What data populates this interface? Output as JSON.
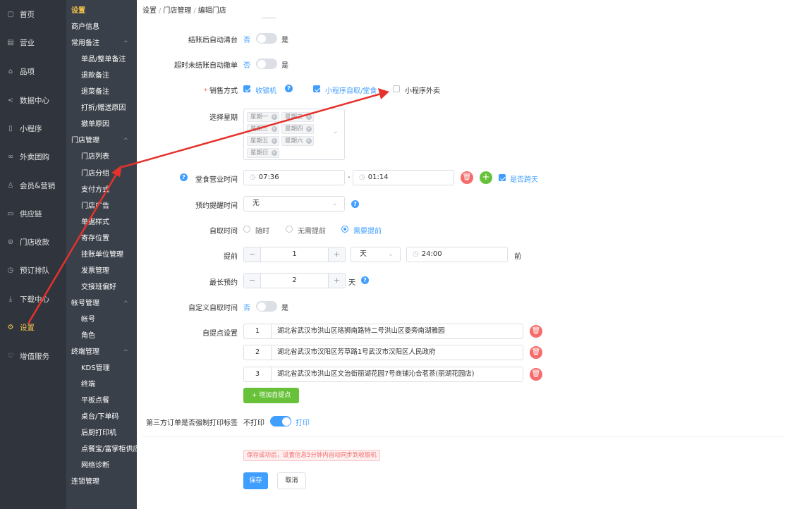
{
  "nav_main": [
    {
      "label": "首页",
      "icon": "home-icon",
      "glyph": "▢",
      "active": false
    },
    {
      "label": "营业",
      "icon": "business-icon",
      "glyph": "▤",
      "active": false
    },
    {
      "label": "品项",
      "icon": "product-icon",
      "glyph": "⌂",
      "active": false
    },
    {
      "label": "数据中心",
      "icon": "share-icon",
      "glyph": "<",
      "active": false
    },
    {
      "label": "小程序",
      "icon": "phone-icon",
      "glyph": "▯",
      "active": false
    },
    {
      "label": "外卖团购",
      "icon": "delivery-icon",
      "glyph": "∞",
      "active": false
    },
    {
      "label": "会员&营销",
      "icon": "user-icon",
      "glyph": "♙",
      "active": false
    },
    {
      "label": "供应链",
      "icon": "truck-icon",
      "glyph": "▭",
      "active": false
    },
    {
      "label": "门店收款",
      "icon": "cashier-icon",
      "glyph": "⊜",
      "active": false
    },
    {
      "label": "预订排队",
      "icon": "clock-icon",
      "glyph": "◷",
      "active": false
    },
    {
      "label": "下载中心",
      "icon": "download-icon",
      "glyph": "⤓",
      "active": false
    },
    {
      "label": "设置",
      "icon": "settings-icon",
      "glyph": "⚙",
      "active": true
    },
    {
      "label": "增值服务",
      "icon": "gift-icon",
      "glyph": "♡",
      "active": false
    }
  ],
  "nav_sub": [
    {
      "type": "title",
      "label": "设置"
    },
    {
      "type": "group",
      "label": "商户信息"
    },
    {
      "type": "group",
      "label": "常用备注",
      "caret": "^"
    },
    {
      "type": "sub",
      "label": "单品/整单备注"
    },
    {
      "type": "sub",
      "label": "退款备注"
    },
    {
      "type": "sub",
      "label": "退菜备注"
    },
    {
      "type": "sub",
      "label": "打折/赠送原因"
    },
    {
      "type": "sub",
      "label": "撤单原因"
    },
    {
      "type": "group",
      "label": "门店管理",
      "caret": "^"
    },
    {
      "type": "sub",
      "label": "门店列表"
    },
    {
      "type": "sub",
      "label": "门店分组"
    },
    {
      "type": "sub",
      "label": "支付方式"
    },
    {
      "type": "sub",
      "label": "门店广告"
    },
    {
      "type": "sub",
      "label": "单据样式"
    },
    {
      "type": "sub",
      "label": "寄存位置"
    },
    {
      "type": "sub",
      "label": "挂账单位管理"
    },
    {
      "type": "sub",
      "label": "发票管理"
    },
    {
      "type": "sub",
      "label": "交接班偏好"
    },
    {
      "type": "group",
      "label": "帐号管理",
      "caret": "^"
    },
    {
      "type": "sub",
      "label": "帐号"
    },
    {
      "type": "sub",
      "label": "角色"
    },
    {
      "type": "group",
      "label": "终端管理",
      "caret": "^"
    },
    {
      "type": "sub",
      "label": "KDS管理"
    },
    {
      "type": "sub",
      "label": "终端"
    },
    {
      "type": "sub",
      "label": "平板点餐"
    },
    {
      "type": "sub",
      "label": "桌台/下单码"
    },
    {
      "type": "sub",
      "label": "后厨打印机"
    },
    {
      "type": "sub",
      "label": "点餐宝/富掌柜供应"
    },
    {
      "type": "sub",
      "label": "网络诊断"
    },
    {
      "type": "group",
      "label": "连锁管理"
    }
  ],
  "breadcrumb": {
    "a": "设置",
    "b": "门店管理",
    "c": "编辑门店",
    "sep": "/"
  },
  "form": {
    "auto_clear": {
      "label": "结账后自动清台",
      "off": "否",
      "on": "是",
      "value": false
    },
    "auto_cancel": {
      "label": "超时未结账自动撤单",
      "off": "否",
      "on": "是",
      "value": false
    },
    "sales": {
      "label": "销售方式",
      "req": "*",
      "options": [
        {
          "label": "收银机",
          "checked": true
        },
        {
          "label": "小程序自取/堂食",
          "checked": true
        },
        {
          "label": "小程序外卖",
          "checked": false
        }
      ]
    },
    "weekdays": {
      "label": "选择星期",
      "tags": [
        "星期一",
        "星期二",
        "星期三",
        "星期四",
        "星期五",
        "星期六",
        "星期日"
      ],
      "chevron": "⌄"
    },
    "dine_hours": {
      "label": "堂食营业时间",
      "start": "07:36",
      "end": "01:14",
      "dash": "-",
      "cross_day": "是否跨天",
      "cross_checked": true,
      "add": "+",
      "del": "🗑"
    },
    "reminder": {
      "label": "预约提醒时间",
      "value": "无"
    },
    "pickup": {
      "label": "自取时间",
      "options": [
        {
          "label": "随时",
          "checked": false
        },
        {
          "label": "无需提前",
          "checked": false
        },
        {
          "label": "需要提前",
          "checked": true
        }
      ]
    },
    "advance": {
      "label": "提前",
      "value": "1",
      "unit": "天",
      "time": "24:00",
      "suffix": "前",
      "minus": "−",
      "plus": "+"
    },
    "max_booking": {
      "label": "最长预约",
      "value": "2",
      "unit": "天",
      "minus": "−",
      "plus": "+"
    },
    "custom_pickup": {
      "label": "自定义自取时间",
      "off": "否",
      "on": "是",
      "value": false
    },
    "pickup_points": {
      "label": "自提点设置",
      "items": [
        {
          "num": "1",
          "address": "湖北省武汉市洪山区珞狮南路特二号洪山区委旁南湖雅园"
        },
        {
          "num": "2",
          "address": "湖北省武汉市汉阳区芳草路1号武汉市汉阳区人民政府"
        },
        {
          "num": "3",
          "address": "湖北省武汉市洪山区文治街丽湖花园7号商铺沁合茗茶(丽湖花园店)"
        }
      ],
      "add_label": "+ 增加自提点"
    },
    "force_print": {
      "label": "第三方订单是否强制打印标签",
      "off": "不打印",
      "on": "打印",
      "value": true
    }
  },
  "notice": "保存成功后，设置信息5分钟内自动同步到收银机",
  "buttons": {
    "save": "保存",
    "cancel": "取消"
  },
  "colors": {
    "primary": "#409eff",
    "danger": "#f56c6c",
    "success": "#67c23a",
    "sidebar": "#30353d",
    "active": "#f3c24a",
    "arrow": "#e5322d"
  },
  "symbols": {
    "help": "?",
    "clock": "◷",
    "dropdown": "⌄",
    "tag_close": "×"
  }
}
